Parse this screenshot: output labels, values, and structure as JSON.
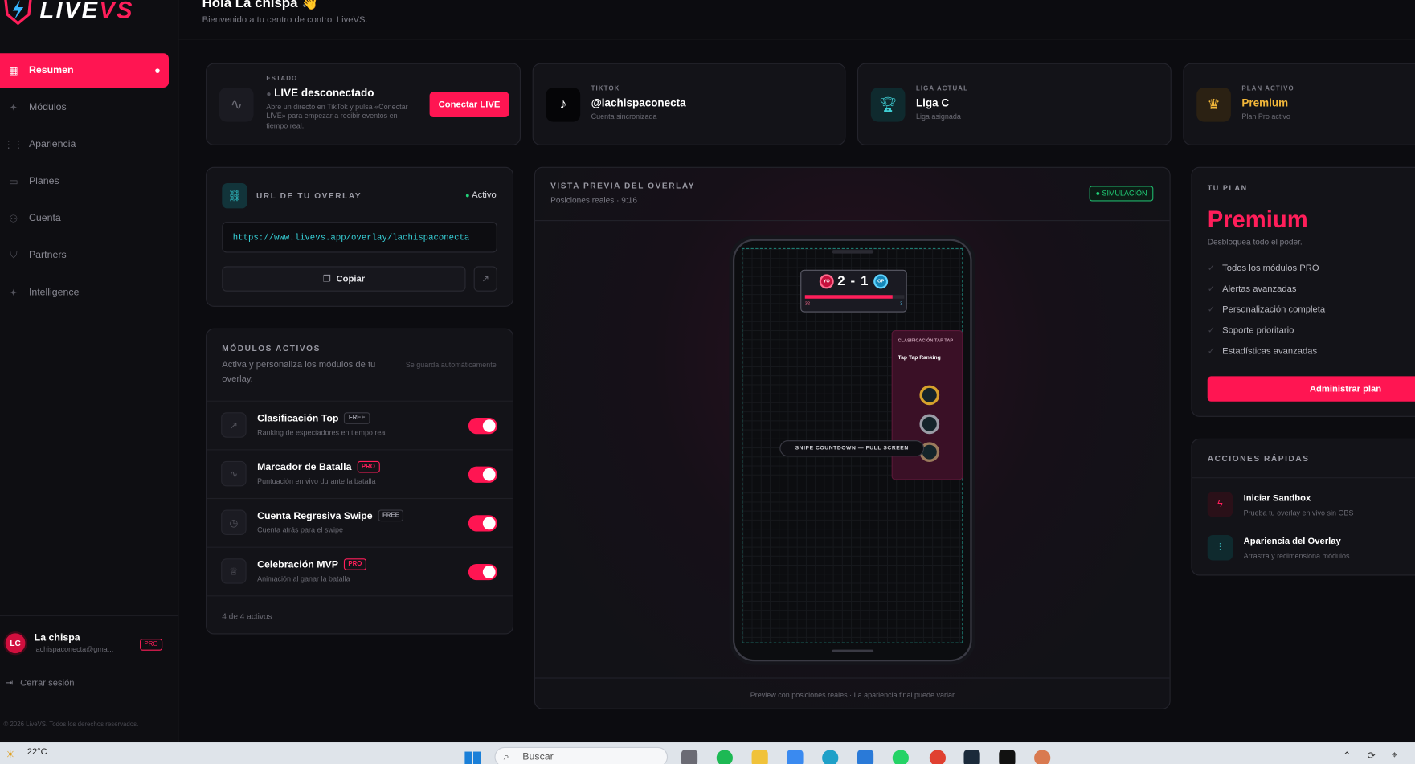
{
  "app": {
    "logo_text": "LIVE",
    "logo_vs": "VS"
  },
  "sidebar": {
    "items": [
      {
        "label": "Resumen",
        "icon": "grid-icon",
        "active": true
      },
      {
        "label": "Módulos",
        "icon": "sparkles-icon"
      },
      {
        "label": "Apariencia",
        "icon": "sliders-icon"
      },
      {
        "label": "Planes",
        "icon": "card-icon"
      },
      {
        "label": "Cuenta",
        "icon": "user-icon"
      },
      {
        "label": "Partners",
        "icon": "handshake-icon"
      },
      {
        "label": "Intelligence",
        "icon": "sparkles-icon"
      }
    ],
    "user": {
      "initials": "LC",
      "name": "La chispa",
      "email": "lachispaconecta@gma...",
      "badge": "PRO"
    },
    "logout": "Cerrar sesión",
    "copyright": "© 2026 LiveVS. Todos los derechos reservados."
  },
  "header": {
    "title": "Hola La chispa 👋",
    "subtitle": "Bienvenido a tu centro de control LiveVS."
  },
  "stats": {
    "estado": {
      "kicker": "ESTADO",
      "main": "LIVE desconectado",
      "sub": "Abre un directo en TikTok y pulsa «Conectar LIVE» para empezar a recibir eventos en tiempo real.",
      "button": "Conectar LIVE"
    },
    "tiktok": {
      "kicker": "TIKTOK",
      "main": "@lachispaconecta",
      "sub": "Cuenta sincronizada"
    },
    "liga": {
      "kicker": "LIGA ACTUAL",
      "main": "Liga C",
      "sub": "Liga asignada"
    },
    "plan": {
      "kicker": "PLAN ACTIVO",
      "main": "Premium",
      "sub": "Plan Pro activo"
    }
  },
  "overlay_url": {
    "kicker": "URL DE TU OVERLAY",
    "status": "Activo",
    "url": "https://www.livevs.app/overlay/lachispaconecta",
    "copy": "Copiar"
  },
  "modules": {
    "kicker": "MÓDULOS ACTIVOS",
    "desc": "Activa y personaliza los módulos de tu overlay.",
    "autosave": "Se guarda automáticamente",
    "items": [
      {
        "title": "Clasificación Top",
        "tag": "FREE",
        "sub": "Ranking de espectadores en tiempo real",
        "icon": "trending-icon"
      },
      {
        "title": "Marcador de Batalla",
        "tag": "PRO",
        "sub": "Puntuación en vivo durante la batalla",
        "icon": "pulse-icon"
      },
      {
        "title": "Cuenta Regresiva Swipe",
        "tag": "FREE",
        "sub": "Cuenta atrás para el swipe",
        "icon": "clock-icon"
      },
      {
        "title": "Celebración MVP",
        "tag": "PRO",
        "sub": "Animación al ganar la batalla",
        "icon": "trophy-icon"
      }
    ],
    "footer": "4 de 4 activos"
  },
  "preview": {
    "kicker": "VISTA PREVIA DEL OVERLAY",
    "sub": "Posiciones reales · 9:16",
    "badge": "SIMULACIÓN",
    "score_left": "YO",
    "score_right": "OP",
    "score": "2 - 1",
    "bar_left": "32",
    "bar_right": "3",
    "ranking_kicker": "CLASIFICACIÓN TAP TAP",
    "ranking_title": "Tap Tap Ranking",
    "countdown": "SNIPE COUNTDOWN — FULL SCREEN",
    "footer": "Preview con posiciones reales · La apariencia final puede variar."
  },
  "plan": {
    "kicker": "TU PLAN",
    "name": "Premium",
    "desc": "Desbloquea todo el poder.",
    "features": [
      "Todos los módulos PRO",
      "Alertas avanzadas",
      "Personalización completa",
      "Soporte prioritario",
      "Estadísticas avanzadas"
    ],
    "button": "Administrar plan"
  },
  "quick": {
    "kicker": "ACCIONES RÁPIDAS",
    "items": [
      {
        "title": "Iniciar Sandbox",
        "sub": "Prueba tu overlay en vivo sin OBS",
        "icon": "bolt-icon"
      },
      {
        "title": "Apariencia del Overlay",
        "sub": "Arrastra y redimensiona módulos",
        "icon": "sliders-icon"
      }
    ]
  },
  "taskbar": {
    "weather": "22°C",
    "search": "Buscar"
  }
}
